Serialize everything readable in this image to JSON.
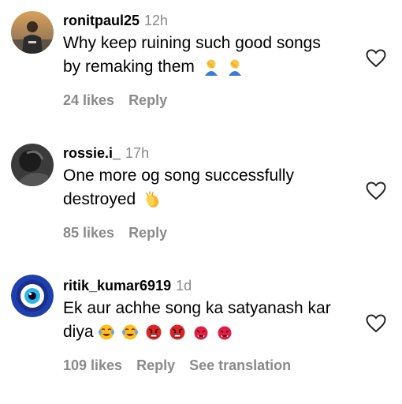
{
  "comments": [
    {
      "username": "ronitpaul25",
      "time": "12h",
      "text_line1": "Why keep ruining such good songs",
      "text_line2": "by remaking them",
      "emojis": [
        "person-facepalming",
        "person-facepalming"
      ],
      "likes": "24 likes",
      "reply": "Reply"
    },
    {
      "username": "rossie.i_",
      "time": "17h",
      "text_line1": "One more og song successfully",
      "text_line2": "destroyed",
      "emojis": [
        "clapping-hands"
      ],
      "likes": "85 likes",
      "reply": "Reply"
    },
    {
      "username": "ritik_kumar6919",
      "time": "1d",
      "text_line1": "Ek aur achhe song ka satyanash kar",
      "text_line2": "diya",
      "emojis": [
        "face-with-tears-of-joy",
        "face-with-tears-of-joy",
        "angry-face",
        "angry-face",
        "ogre",
        "ogre"
      ],
      "likes": "109 likes",
      "reply": "Reply",
      "see_translation": "See translation"
    }
  ],
  "colors": {
    "meta_gray": "#8a8a8a",
    "text": "#000000",
    "evil_eye_blue": "#1e3fae"
  },
  "icons": {
    "like": "heart-outline-icon"
  }
}
